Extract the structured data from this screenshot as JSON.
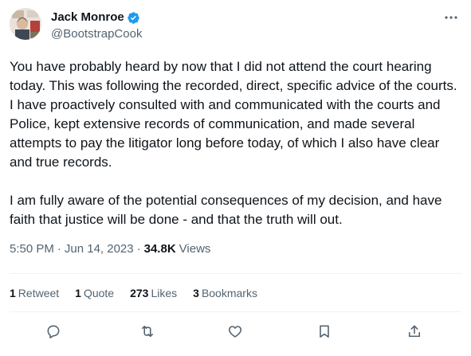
{
  "author": {
    "display_name": "Jack Monroe",
    "handle": "@BootstrapCook",
    "verified_icon": "verified-badge-icon",
    "avatar": "profile-photo"
  },
  "tweet": {
    "paragraphs": [
      "You have probably heard by now that I did not attend the court hearing today. This was following the recorded, direct, specific advice of the courts. I have proactively consulted with and communicated with the courts and Police, kept extensive records of communication, and made several attempts to pay the litigator long before today, of which I also have clear and true records.",
      "I am fully aware of the potential consequences of my decision, and have faith that justice will be done - and that the truth will out."
    ],
    "time": "5:50 PM",
    "separator": "·",
    "date": "Jun 14, 2023",
    "views_count": "34.8K",
    "views_label": "Views"
  },
  "stats": {
    "retweets": {
      "count": "1",
      "label": "Retweet"
    },
    "quotes": {
      "count": "1",
      "label": "Quote"
    },
    "likes": {
      "count": "273",
      "label": "Likes"
    },
    "bookmarks": {
      "count": "3",
      "label": "Bookmarks"
    }
  },
  "actions": [
    "reply-icon",
    "retweet-icon",
    "like-icon",
    "bookmark-icon",
    "share-icon"
  ],
  "colors": {
    "text": "#0f1419",
    "secondary": "#536471",
    "verified": "#1d9bf0",
    "divider": "#eff3f4"
  }
}
